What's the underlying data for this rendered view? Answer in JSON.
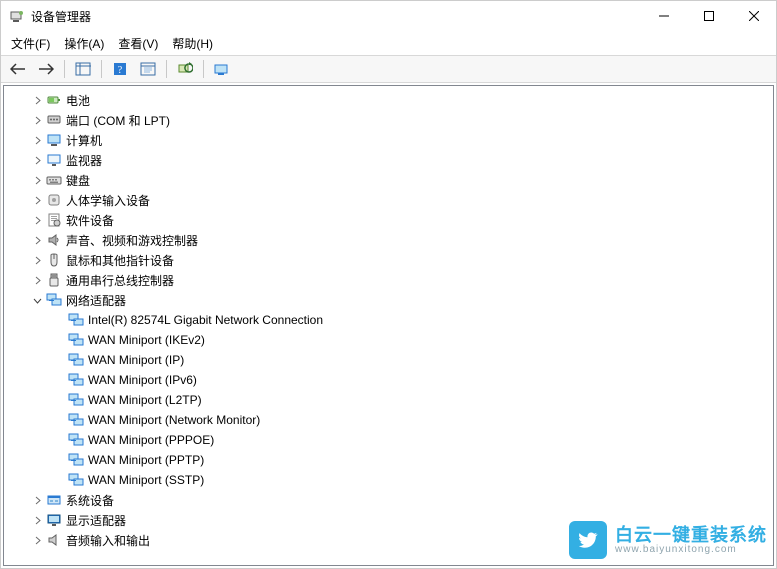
{
  "window": {
    "title": "设备管理器"
  },
  "menu": {
    "file": "文件(F)",
    "action": "操作(A)",
    "view": "查看(V)",
    "help": "帮助(H)"
  },
  "tree": {
    "nodes": [
      {
        "label": "电池",
        "iconKey": "battery",
        "expanded": false
      },
      {
        "label": "端口 (COM 和 LPT)",
        "iconKey": "port",
        "expanded": false
      },
      {
        "label": "计算机",
        "iconKey": "computer",
        "expanded": false
      },
      {
        "label": "监视器",
        "iconKey": "monitor",
        "expanded": false
      },
      {
        "label": "键盘",
        "iconKey": "keyboard",
        "expanded": false
      },
      {
        "label": "人体学输入设备",
        "iconKey": "hid",
        "expanded": false
      },
      {
        "label": "软件设备",
        "iconKey": "software",
        "expanded": false
      },
      {
        "label": "声音、视频和游戏控制器",
        "iconKey": "sound",
        "expanded": false
      },
      {
        "label": "鼠标和其他指针设备",
        "iconKey": "mouse",
        "expanded": false
      },
      {
        "label": "通用串行总线控制器",
        "iconKey": "usb",
        "expanded": false
      },
      {
        "label": "网络适配器",
        "iconKey": "network",
        "expanded": true,
        "children": [
          {
            "label": "Intel(R) 82574L Gigabit Network Connection",
            "iconKey": "network"
          },
          {
            "label": "WAN Miniport (IKEv2)",
            "iconKey": "network"
          },
          {
            "label": "WAN Miniport (IP)",
            "iconKey": "network"
          },
          {
            "label": "WAN Miniport (IPv6)",
            "iconKey": "network"
          },
          {
            "label": "WAN Miniport (L2TP)",
            "iconKey": "network"
          },
          {
            "label": "WAN Miniport (Network Monitor)",
            "iconKey": "network"
          },
          {
            "label": "WAN Miniport (PPPOE)",
            "iconKey": "network"
          },
          {
            "label": "WAN Miniport (PPTP)",
            "iconKey": "network"
          },
          {
            "label": "WAN Miniport (SSTP)",
            "iconKey": "network"
          }
        ]
      },
      {
        "label": "系统设备",
        "iconKey": "system",
        "expanded": false
      },
      {
        "label": "显示适配器",
        "iconKey": "display",
        "expanded": false
      },
      {
        "label": "音频输入和输出",
        "iconKey": "audio",
        "expanded": false
      }
    ]
  },
  "watermark": {
    "cn": "白云一键重装系统",
    "en": "www.baiyunxitong.com"
  }
}
